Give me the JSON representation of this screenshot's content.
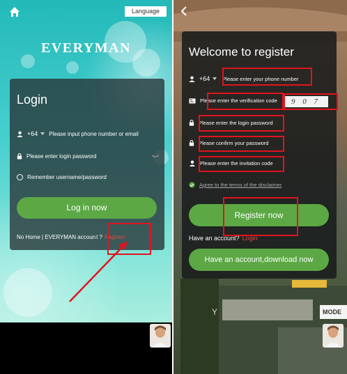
{
  "left_screen": {
    "language_button": "Language",
    "brand": "EVERYMAN",
    "login_title": "Login",
    "country_code": "+64",
    "phone_placeholder": "Please input phone number or email",
    "password_placeholder": "Please enter login password",
    "remember_label": "Remember username/password",
    "login_button": "Log in now",
    "footer_text": "No Home | EVERYMAN accoun",
    "footer_question": "t ?",
    "register_link": "Register",
    "icons": [
      "home-icon",
      "person-icon",
      "chevron-down-icon",
      "lock-icon",
      "eye-off-icon",
      "radio-icon",
      "arrow-icon",
      "avatar"
    ]
  },
  "right_screen": {
    "title": "Welcome to register",
    "country_code": "+64",
    "phone_placeholder": "Please enter your phone number",
    "verification_placeholder": "Please enter the verification code",
    "captcha_text": "9 0 7",
    "login_password_placeholder": "Please enter the login password",
    "confirm_password_placeholder": "Please confirm your password",
    "invitation_placeholder": "Please enter the invitation code",
    "agree_label": "Agree to the terms of the disclaimer",
    "register_button": "Register now",
    "have_account": "Have an account?",
    "login_link": "Login",
    "download_button": "Have an account,download now",
    "sign_text": "MODE",
    "building_text": "Y",
    "icons": [
      "back-icon",
      "person-icon",
      "chevron-down-icon",
      "card-icon",
      "lock-icon",
      "person-badge-icon",
      "check-circle-icon",
      "avatar"
    ]
  },
  "colors": {
    "accent_green": "#5ca845",
    "highlight_red": "#e0141e",
    "link_red": "#e8473f"
  }
}
